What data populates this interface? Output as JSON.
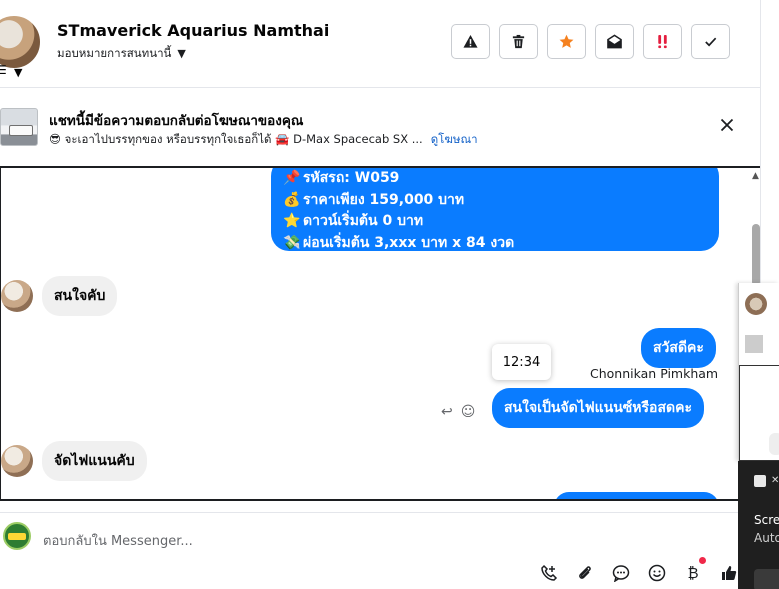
{
  "header": {
    "contact_name": "STmaverick Aquarius Namthai",
    "assignment_label": "มอบหมายการสนทนานี้",
    "actions": [
      {
        "name": "report-spam",
        "icon": "warning-icon"
      },
      {
        "name": "delete",
        "icon": "trash-icon"
      },
      {
        "name": "star",
        "icon": "star-icon"
      },
      {
        "name": "mark-unread",
        "icon": "envelope-open-icon"
      },
      {
        "name": "important",
        "icon": "double-exclamation-icon"
      },
      {
        "name": "done",
        "icon": "checkmark-icon"
      }
    ]
  },
  "ad_banner": {
    "title": "แชทนี้มีข้อความตอบกลับต่อโฆษณาของคุณ",
    "ad_text": "😎 จะเอาไปบรรทุกของ หรือบรรทุกใจเธอก็ได้ 🚘 D-Max Spacecab SX ...",
    "link_label": "ดูโฆษณา"
  },
  "messages": {
    "info_lines": [
      {
        "icon": "📌",
        "text": "รหัสรถ: W059"
      },
      {
        "icon": "💰",
        "text": "ราคาเพียง 159,000 บาท"
      },
      {
        "icon": "⭐",
        "text": "ดาวน์เริ่มต้น 0 บาท"
      },
      {
        "icon": "💸",
        "text": "ผ่อนเริ่มต้น 3,xxx บาท x 84 งวด"
      }
    ],
    "incoming_1": "สนใจคับ",
    "outgoing_1": "สวัสดีคะ",
    "sender_name": "Chonnikan Pimkham",
    "outgoing_2": "สนใจเป็นจัดไฟแนนซ์หรือสดคะ",
    "incoming_2": "จัดไฟแนนคับ",
    "tooltip_time": "12:34"
  },
  "composer": {
    "placeholder": "ตอบกลับใน Messenger..."
  },
  "background_window": {
    "notification_title": "Scre",
    "notification_sub": "Auto"
  },
  "colors": {
    "accent_blue": "#0a7cff",
    "incoming_gray": "#f0f0f0",
    "star_orange": "#f5811f",
    "important_red": "#e41e3f"
  }
}
